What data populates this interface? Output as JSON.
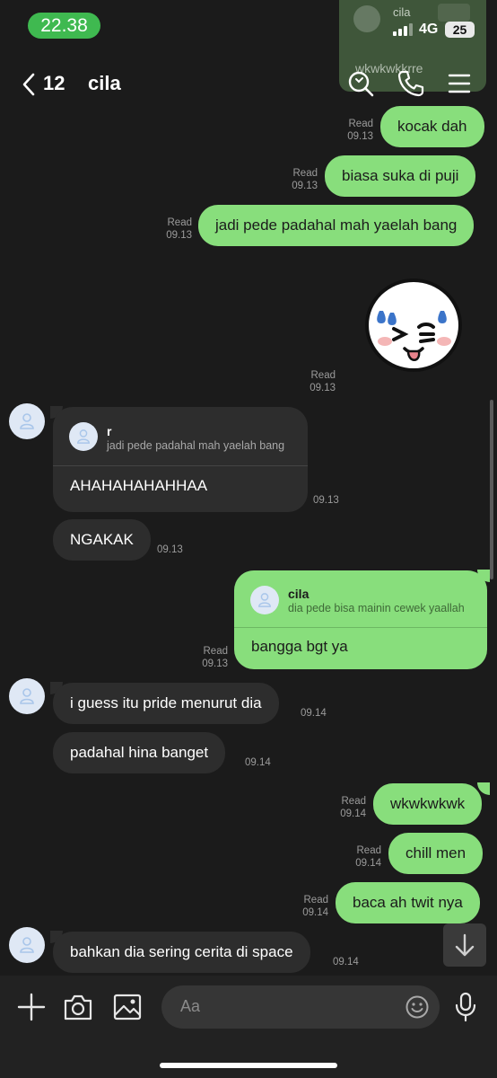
{
  "status_bar": {
    "time": "22.38",
    "network": "4G",
    "battery": "25"
  },
  "header": {
    "back_count": "12",
    "title": "cila",
    "icons": [
      "search-icon",
      "phone-icon",
      "menu-icon"
    ]
  },
  "preview_card": {
    "name": "cila",
    "text": "wkwkwkkrre"
  },
  "messages": {
    "m1": {
      "text": "kocak dah",
      "read": "Read",
      "time": "09.13"
    },
    "m2": {
      "text": "biasa suka di puji",
      "read": "Read",
      "time": "09.13"
    },
    "m3": {
      "text": "jadi pede padahal mah yaelah bang",
      "read": "Read",
      "time": "09.13"
    },
    "sticker": {
      "read": "Read",
      "time": "09.13"
    },
    "m4": {
      "reply_name": "r",
      "reply_text": "jadi pede padahal mah yaelah bang",
      "text": "AHAHAHAHAHHAA",
      "time": "09.13"
    },
    "m5": {
      "text": "NGAKAK",
      "time": "09.13"
    },
    "m6": {
      "reply_name": "cila",
      "reply_text": "dia pede bisa mainin cewek yaallah",
      "text": "bangga bgt ya",
      "read": "Read",
      "time": "09.13"
    },
    "m7": {
      "text": "i guess itu pride menurut dia",
      "time": "09.14"
    },
    "m8": {
      "text": "padahal hina banget",
      "time": "09.14"
    },
    "m9": {
      "text": "wkwkwkwk",
      "read": "Read",
      "time": "09.14"
    },
    "m10": {
      "text": "chill men",
      "read": "Read",
      "time": "09.14"
    },
    "m11": {
      "text": "baca ah twit nya",
      "read": "Read",
      "time": "09.14"
    },
    "m12": {
      "text": "bahkan dia sering cerita di space",
      "time": "09.14"
    }
  },
  "composer": {
    "placeholder": "Aa"
  },
  "colors": {
    "outgoing": "#88de7c",
    "incoming": "#2d2d2d",
    "background": "#1b1b1b",
    "status_pill": "#3fb950"
  }
}
